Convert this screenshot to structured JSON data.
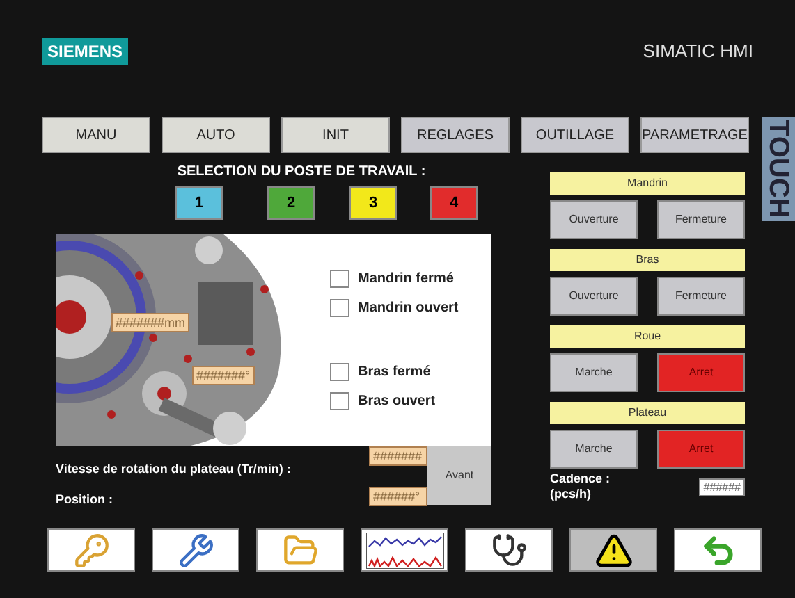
{
  "header": {
    "logo": "SIEMENS",
    "product": "SIMATIC HMI",
    "badge": "TOUCH"
  },
  "tabs": [
    {
      "label": "MANU",
      "highlighted": false
    },
    {
      "label": "AUTO",
      "highlighted": false
    },
    {
      "label": "INIT",
      "highlighted": false
    },
    {
      "label": "REGLAGES",
      "highlighted": true
    },
    {
      "label": "OUTILLAGE",
      "highlighted": true
    },
    {
      "label": "PARAMETRAGE",
      "highlighted": true
    }
  ],
  "station_selection": {
    "title": "SELECTION DU POSTE DE TRAVAIL :",
    "stations": [
      {
        "label": "1",
        "color": "#5bc0dc"
      },
      {
        "label": "2",
        "color": "#4fa83a"
      },
      {
        "label": "3",
        "color": "#f2e81a"
      },
      {
        "label": "4",
        "color": "#e12c2c"
      }
    ]
  },
  "machine_view": {
    "fields": [
      "#######mm",
      "#######°"
    ],
    "indicators": [
      {
        "label": "Mandrin fermé",
        "checked": false
      },
      {
        "label": "Mandrin ouvert",
        "checked": false
      },
      {
        "label": "Bras fermé",
        "checked": false
      },
      {
        "label": "Bras ouvert",
        "checked": false
      }
    ]
  },
  "readouts": [
    {
      "label": "Vitesse de rotation du plateau (Tr/min) :",
      "value": "#######"
    },
    {
      "label": "Position :",
      "value": "######°"
    }
  ],
  "avant_button": "Avant",
  "controls": [
    {
      "title": "Mandrin",
      "buttons": [
        {
          "label": "Ouverture",
          "active": false
        },
        {
          "label": "Fermeture",
          "active": false
        }
      ]
    },
    {
      "title": "Bras",
      "buttons": [
        {
          "label": "Ouverture",
          "active": false
        },
        {
          "label": "Fermeture",
          "active": false
        }
      ]
    },
    {
      "title": "Roue",
      "buttons": [
        {
          "label": "Marche",
          "active": false
        },
        {
          "label": "Arret",
          "active": true
        }
      ]
    },
    {
      "title": "Plateau",
      "buttons": [
        {
          "label": "Marche",
          "active": false
        },
        {
          "label": "Arret",
          "active": true
        }
      ]
    }
  ],
  "cadence": {
    "label": "Cadence :",
    "unit": "(pcs/h)",
    "value": "######"
  },
  "toolbar": [
    {
      "kind": "key",
      "highlighted": false
    },
    {
      "kind": "tools",
      "highlighted": false
    },
    {
      "kind": "folder",
      "highlighted": false
    },
    {
      "kind": "trend",
      "highlighted": false
    },
    {
      "kind": "stethoscope",
      "highlighted": false
    },
    {
      "kind": "warning",
      "highlighted": true
    },
    {
      "kind": "back",
      "highlighted": false
    }
  ]
}
